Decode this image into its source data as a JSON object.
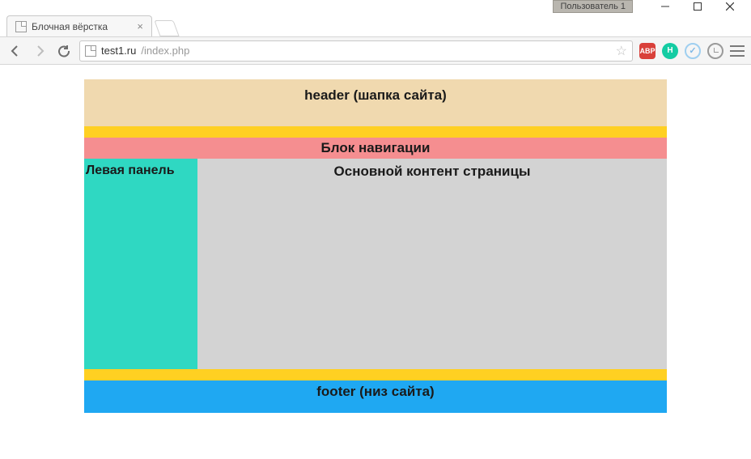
{
  "window": {
    "user_badge": "Пользователь 1"
  },
  "tab": {
    "title": "Блочная вёрстка"
  },
  "address": {
    "host": "test1.ru",
    "path": "/index.php"
  },
  "extensions": {
    "abp": "ABP",
    "h": "H"
  },
  "page": {
    "header": "header (шапка сайта)",
    "nav": "Блок навигации",
    "left_panel": "Левая панель",
    "main": "Основной контент страницы",
    "footer": "footer (низ сайта)"
  }
}
